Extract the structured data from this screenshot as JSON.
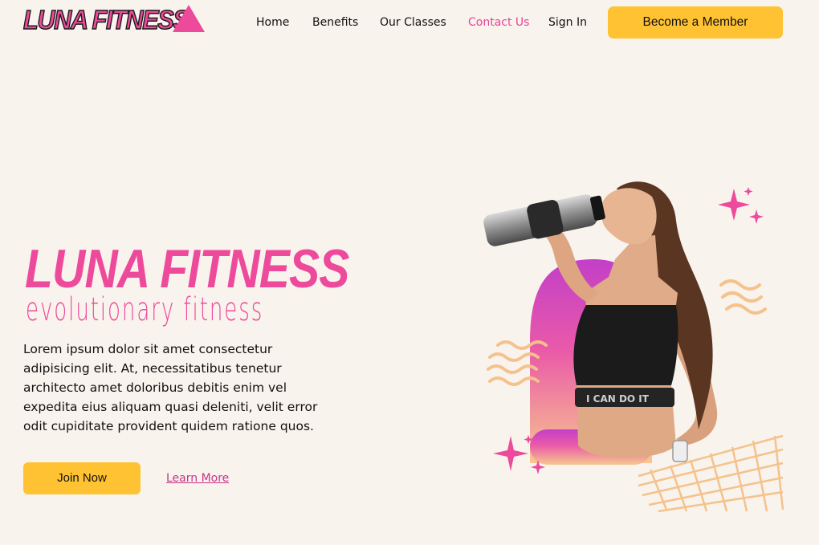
{
  "brand": {
    "logo_text": "LUNA FITNESS"
  },
  "nav": {
    "items": [
      {
        "label": "Home",
        "active": false
      },
      {
        "label": "Benefits",
        "active": false
      },
      {
        "label": "Our Classes",
        "active": false
      },
      {
        "label": "Contact Us",
        "active": true
      },
      {
        "label": "Sign In",
        "active": false
      }
    ],
    "cta_label": "Become a Member"
  },
  "hero": {
    "title": "LUNA FITNESS",
    "subtitle": "evolutionary fitness",
    "description": "Lorem ipsum dolor sit amet consectetur adipisicing elit. At, necessitatibus tenetur architecto amet doloribus debitis enim vel expedita eius aliquam quasi deleniti, velit error odit cupiditate provident quidem ratione quos.",
    "join_label": "Join Now",
    "learn_label": "Learn More",
    "shirt_text": "I CAN DO IT"
  },
  "colors": {
    "background": "#f8f3ec",
    "accent_pink": "#ee4a9c",
    "accent_yellow": "#ffc233",
    "peach": "#f5c28c"
  }
}
